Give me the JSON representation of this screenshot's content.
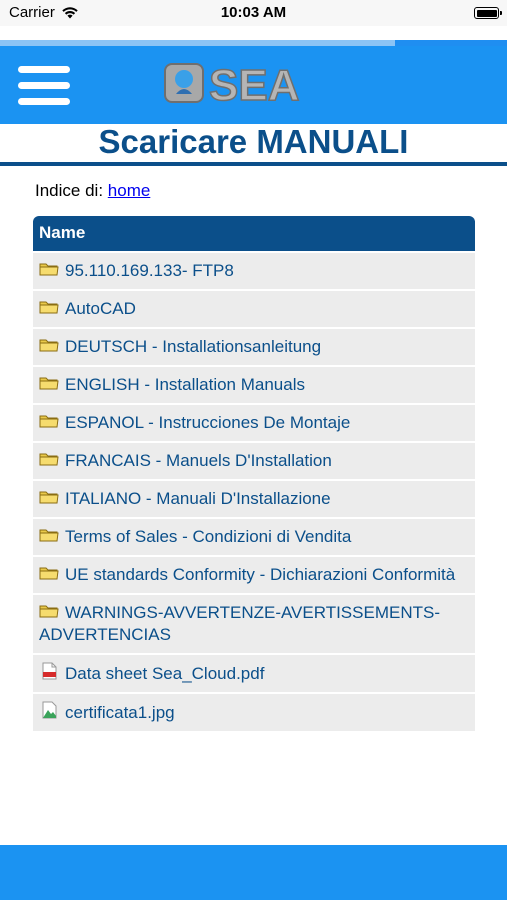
{
  "status_bar": {
    "carrier": "Carrier",
    "time": "10:03 AM"
  },
  "loading": {
    "progress": 0.78
  },
  "header": {
    "logo_text": "SEA",
    "menu_icon": "hamburger-icon"
  },
  "page": {
    "title": "Scaricare MANUALI",
    "index_label": "Indice di:",
    "home_link": "home"
  },
  "table": {
    "header": "Name",
    "rows": [
      {
        "label": "95.110.169.133- FTP8",
        "icon": "folder-icon"
      },
      {
        "label": "AutoCAD",
        "icon": "folder-icon"
      },
      {
        "label": "DEUTSCH - Installationsanleitung",
        "icon": "folder-icon"
      },
      {
        "label": "ENGLISH - Installation Manuals",
        "icon": "folder-icon"
      },
      {
        "label": "ESPANOL - Instrucciones De Montaje",
        "icon": "folder-icon"
      },
      {
        "label": "FRANCAIS - Manuels D'Installation",
        "icon": "folder-icon"
      },
      {
        "label": "ITALIANO - Manuali D'Installazione",
        "icon": "folder-icon"
      },
      {
        "label": "Terms of Sales - Condizioni di Vendita",
        "icon": "folder-icon"
      },
      {
        "label": "UE standards Conformity - Dichiarazioni Conformità",
        "icon": "folder-icon"
      },
      {
        "label": "WARNINGS-AVVERTENZE-AVERTISSEMENTS-ADVERTENCIAS",
        "icon": "folder-icon"
      },
      {
        "label": "Data sheet Sea_Cloud.pdf",
        "icon": "pdf-file-icon"
      },
      {
        "label": "certificata1.jpg",
        "icon": "image-file-icon"
      }
    ]
  },
  "colors": {
    "brand_blue": "#1b93f2",
    "dark_blue": "#0b4f8a",
    "row_bg": "#ececec"
  }
}
